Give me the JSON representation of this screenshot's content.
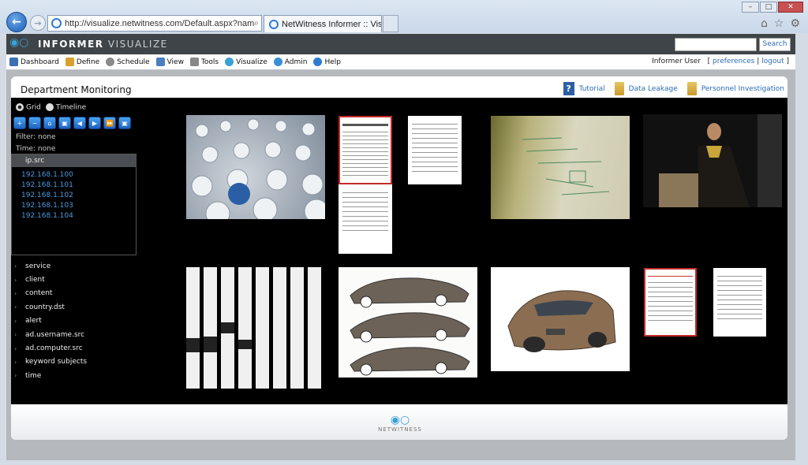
{
  "browser": {
    "url": "http://visualize.netwitness.com/Default.aspx?nam",
    "tab_title": "NetWitness Informer :: Vis...",
    "controls": "⌕ ▾ ↻ ✕",
    "tab_close": "✕"
  },
  "app": {
    "brand_strong": "INFORMER",
    "brand_light": "VISUALIZE",
    "search_button": "Search",
    "search_value": ""
  },
  "menu": {
    "items": [
      {
        "label": "Dashboard",
        "icon": "dashboard-icon",
        "color": "#3a6fb5"
      },
      {
        "label": "Define",
        "icon": "pencil-icon",
        "color": "#d9a030"
      },
      {
        "label": "Schedule",
        "icon": "clock-icon",
        "color": "#8a8a8a"
      },
      {
        "label": "View",
        "icon": "monitor-icon",
        "color": "#4a7fc0"
      },
      {
        "label": "Tools",
        "icon": "wrench-icon",
        "color": "#888"
      },
      {
        "label": "Visualize",
        "icon": "globe-icon",
        "color": "#3aa1d6"
      },
      {
        "label": "Admin",
        "icon": "gear-icon",
        "color": "#3a8fd6"
      },
      {
        "label": "Help",
        "icon": "help-icon",
        "color": "#2d7bd3"
      }
    ],
    "user": "Informer User",
    "preferences": "preferences",
    "logout": "logout"
  },
  "panel": {
    "title": "Department Monitoring",
    "links": [
      "Tutorial",
      "Data Leakage",
      "Personnel Investigation"
    ]
  },
  "view": {
    "grid_label": "Grid",
    "timeline_label": "Timeline",
    "filter": "Filter: none",
    "time": "Time: none",
    "toolbar": [
      "zoom-in-icon",
      "zoom-out-icon",
      "home-icon",
      "fit-icon",
      "first-icon",
      "play-icon",
      "last-icon",
      "lock-icon"
    ]
  },
  "ip_src": {
    "header": "ip.src",
    "values": [
      "192.168.1.100",
      "192.168.1.101",
      "192.168.1.102",
      "192.168.1.103",
      "192.168.1.104"
    ]
  },
  "facets": [
    "service",
    "client",
    "content",
    "country.dst",
    "alert",
    "ad.username.src",
    "ad.computer.src",
    "keyword subjects",
    "time"
  ],
  "footer": {
    "brand": "NETWITNESS"
  }
}
